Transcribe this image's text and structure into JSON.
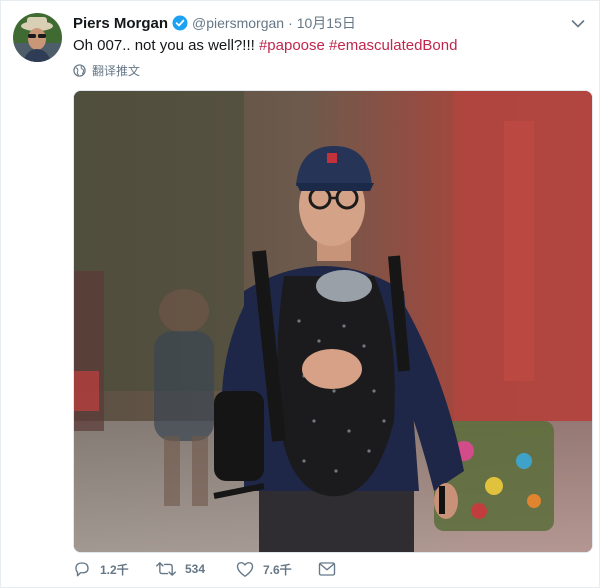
{
  "tweet": {
    "author_name": "Piers Morgan",
    "handle": "@piersmorgan",
    "separator": "·",
    "date": "10月15日",
    "text_plain": "Oh 007.. not you as well?!!! ",
    "hashtags": [
      "#papoose",
      "#emasculatedBond"
    ],
    "translate_label": "翻译推文",
    "media_icon": "photo-of-man-carrying-baby-in-carrier"
  },
  "actions": {
    "reply_count": "1.2千",
    "retweet_count": "534",
    "like_count": "7.6千"
  },
  "colors": {
    "hashtag": "#c0254d",
    "verified": "#1da1f2",
    "muted": "#657786"
  }
}
